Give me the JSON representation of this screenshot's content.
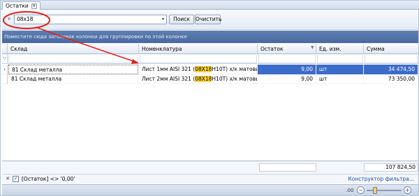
{
  "tab": {
    "label": "Остатки",
    "close_glyph": "✕"
  },
  "find_panel": {
    "clear_glyph": "✕",
    "search_value": "08х18",
    "dropdown_glyph": "▾",
    "search_button": "Поиск",
    "clear_button": "Очистить"
  },
  "group_panel": {
    "hint": "Поместите сюда заголовок колонки для группировки по этой колонке"
  },
  "columns": [
    "Склад",
    "Номенклатура",
    "Остаток",
    "Ед. изм.",
    "Сумма"
  ],
  "rows": [
    {
      "indicator": "›",
      "warehouse": "81 Склад металла",
      "item_before": "Лист 1мм AISI 321 (",
      "item_highlight": "08Х18",
      "item_after": "Н10Т) х/к матовый",
      "qty": "9,00",
      "unit": "шт",
      "sum": "34 474,50"
    },
    {
      "indicator": "",
      "warehouse": "81 Склад металла",
      "item_before": "Лист 2мм AISI 321 (",
      "item_highlight": "08Х18",
      "item_after": "Н10Т) х/к матовый",
      "qty": "9,00",
      "unit": "шт",
      "sum": "73 350,00"
    }
  ],
  "footer": {
    "sum_total": "107 824,50"
  },
  "status_bar": {
    "close_glyph": "✕",
    "check_glyph": "✓",
    "filter_text": "[Остаток] <> '0,00'",
    "builder_link": "Конструктор фильтра..."
  },
  "zoom_bar": {
    "zoom_label": ".00",
    "minus": "−",
    "plus": "+"
  },
  "colors": {
    "selected_cell": "#3c6cc9",
    "highlight": "#ffd431",
    "group_panel": "#5573a8",
    "annotation": "#e0201c"
  }
}
